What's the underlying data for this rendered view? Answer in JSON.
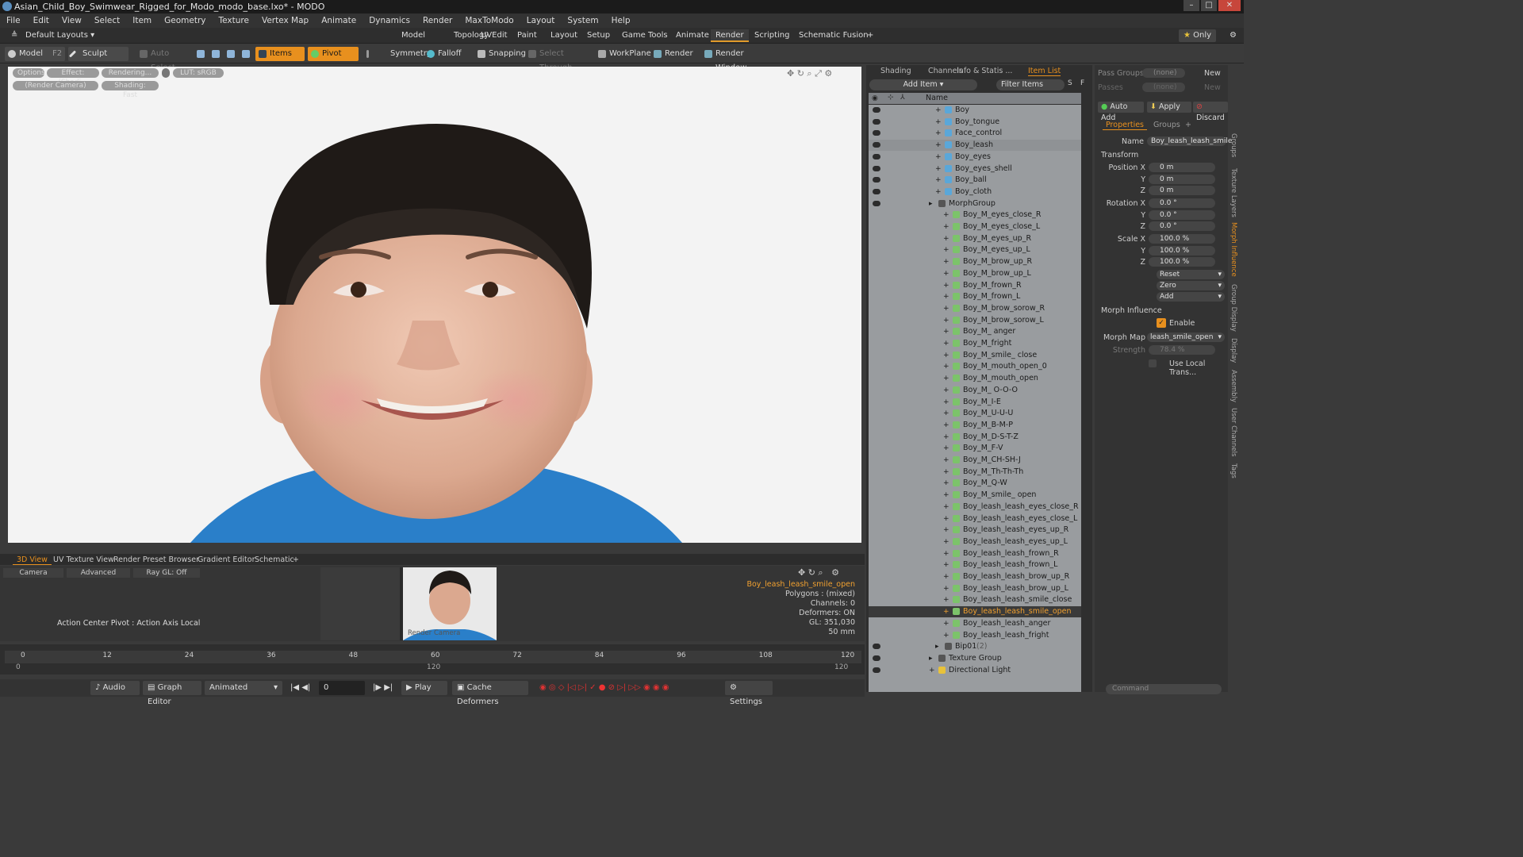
{
  "window": {
    "title": "Asian_Child_Boy_Swimwear_Rigged_for_Modo_modo_base.lxo* - MODO"
  },
  "menu": [
    "File",
    "Edit",
    "View",
    "Select",
    "Item",
    "Geometry",
    "Texture",
    "Vertex Map",
    "Animate",
    "Dynamics",
    "Render",
    "MaxToModo",
    "Layout",
    "System",
    "Help"
  ],
  "layout_label": "Default Layouts",
  "top_tabs": [
    "Model",
    "Topology",
    "UVEdit",
    "Paint",
    "Layout",
    "Setup",
    "Game Tools",
    "Animate",
    "Render",
    "Scripting",
    "Schematic Fusion"
  ],
  "active_top_tab": "Render",
  "only_label": "Only",
  "toolbar": {
    "model": "Model",
    "f2": "F2",
    "sculpt": "Sculpt",
    "auto_select": "Auto Select",
    "items": "Items",
    "pivot": "Pivot",
    "symmetry": "Symmetry",
    "falloff": "Falloff",
    "snapping": "Snapping",
    "select_through": "Select Through",
    "workplane": "WorkPlane",
    "render": "Render",
    "render_window": "Render Window"
  },
  "viewport": {
    "options": "Options",
    "effect": "Effect: (Shadi...",
    "rendering": "Rendering...",
    "lut": "LUT: sRGB",
    "render_camera": "(Render Camera)",
    "shading": "Shading: Fast"
  },
  "bottom_tabs": [
    "3D View",
    "UV Texture View",
    "Render Preset Browser",
    "Gradient Editor",
    "Schematic"
  ],
  "lower": {
    "camera": "Camera",
    "advanced": "Advanced",
    "raygl": "Ray GL: Off",
    "action_center": "Action Center Pivot : Action Axis Local",
    "render_camera": "Render Camera",
    "info_name": "Boy_leash_leash_smile_open",
    "info_lines": [
      "Polygons : (mixed)",
      "Channels: 0",
      "Deformers: ON",
      "GL: 351,030",
      "50 mm"
    ]
  },
  "timeline_ticks": [
    "0",
    "12",
    "24",
    "36",
    "48",
    "60",
    "72",
    "84",
    "96",
    "108",
    "120"
  ],
  "timeline_bottom": {
    "start": "0",
    "mid": "120",
    "end": "120"
  },
  "playbar": {
    "audio": "Audio",
    "graph_editor": "Graph Editor",
    "animated": "Animated",
    "frame": "0",
    "play": "Play",
    "cache": "Cache Deformers",
    "settings": "Settings"
  },
  "right_tabs": [
    "Shading",
    "Channels",
    "Info & Statis ...",
    "Item List"
  ],
  "add_item": "Add Item",
  "filter_items": "Filter Items",
  "tree_header": "Name",
  "tree": [
    {
      "label": "Boy",
      "indent": 1,
      "icon": "mesh"
    },
    {
      "label": "Boy_tongue",
      "indent": 1,
      "icon": "mesh"
    },
    {
      "label": "Face_control",
      "indent": 1,
      "icon": "mesh"
    },
    {
      "label": "Boy_leash",
      "indent": 1,
      "icon": "mesh",
      "hl": true
    },
    {
      "label": "Boy_eyes",
      "indent": 1,
      "icon": "mesh"
    },
    {
      "label": "Boy_eyes_shell",
      "indent": 1,
      "icon": "mesh"
    },
    {
      "label": "Boy_ball",
      "indent": 1,
      "icon": "mesh"
    },
    {
      "label": "Boy_cloth",
      "indent": 1,
      "icon": "mesh"
    },
    {
      "label": "MorphGroup",
      "indent": 0,
      "icon": "group"
    },
    {
      "label": "Boy_M_eyes_close_R",
      "indent": 2,
      "icon": "morph"
    },
    {
      "label": "Boy_M_eyes_close_L",
      "indent": 2,
      "icon": "morph"
    },
    {
      "label": "Boy_M_eyes_up_R",
      "indent": 2,
      "icon": "morph"
    },
    {
      "label": "Boy_M_eyes_up_L",
      "indent": 2,
      "icon": "morph"
    },
    {
      "label": "Boy_M_brow_up_R",
      "indent": 2,
      "icon": "morph"
    },
    {
      "label": "Boy_M_brow_up_L",
      "indent": 2,
      "icon": "morph"
    },
    {
      "label": "Boy_M_frown_R",
      "indent": 2,
      "icon": "morph"
    },
    {
      "label": "Boy_M_frown_L",
      "indent": 2,
      "icon": "morph"
    },
    {
      "label": "Boy_M_brow_sorow_R",
      "indent": 2,
      "icon": "morph"
    },
    {
      "label": "Boy_M_brow_sorow_L",
      "indent": 2,
      "icon": "morph"
    },
    {
      "label": "Boy_M_ anger",
      "indent": 2,
      "icon": "morph"
    },
    {
      "label": "Boy_M_fright",
      "indent": 2,
      "icon": "morph"
    },
    {
      "label": "Boy_M_smile_ close",
      "indent": 2,
      "icon": "morph"
    },
    {
      "label": "Boy_M_mouth_open_0",
      "indent": 2,
      "icon": "morph"
    },
    {
      "label": "Boy_M_mouth_open",
      "indent": 2,
      "icon": "morph"
    },
    {
      "label": "Boy_M_ O-O-O",
      "indent": 2,
      "icon": "morph"
    },
    {
      "label": "Boy_M_I-E",
      "indent": 2,
      "icon": "morph"
    },
    {
      "label": "Boy_M_U-U-U",
      "indent": 2,
      "icon": "morph"
    },
    {
      "label": "Boy_M_B-M-P",
      "indent": 2,
      "icon": "morph"
    },
    {
      "label": "Boy_M_D-S-T-Z",
      "indent": 2,
      "icon": "morph"
    },
    {
      "label": "Boy_M_F-V",
      "indent": 2,
      "icon": "morph"
    },
    {
      "label": "Boy_M_CH-SH-J",
      "indent": 2,
      "icon": "morph"
    },
    {
      "label": "Boy_M_Th-Th-Th",
      "indent": 2,
      "icon": "morph"
    },
    {
      "label": "Boy_M_Q-W",
      "indent": 2,
      "icon": "morph"
    },
    {
      "label": "Boy_M_smile_ open",
      "indent": 2,
      "icon": "morph"
    },
    {
      "label": "Boy_leash_leash_eyes_close_R",
      "indent": 2,
      "icon": "morph"
    },
    {
      "label": "Boy_leash_leash_eyes_close_L",
      "indent": 2,
      "icon": "morph"
    },
    {
      "label": "Boy_leash_leash_eyes_up_R",
      "indent": 2,
      "icon": "morph"
    },
    {
      "label": "Boy_leash_leash_eyes_up_L",
      "indent": 2,
      "icon": "morph"
    },
    {
      "label": "Boy_leash_leash_frown_R",
      "indent": 2,
      "icon": "morph"
    },
    {
      "label": "Boy_leash_leash_frown_L",
      "indent": 2,
      "icon": "morph"
    },
    {
      "label": "Boy_leash_leash_brow_up_R",
      "indent": 2,
      "icon": "morph"
    },
    {
      "label": "Boy_leash_leash_brow_up_L",
      "indent": 2,
      "icon": "morph"
    },
    {
      "label": "Boy_leash_leash_smile_close",
      "indent": 2,
      "icon": "morph"
    },
    {
      "label": "Boy_leash_leash_smile_open",
      "indent": 2,
      "icon": "morph",
      "sel": true
    },
    {
      "label": "Boy_leash_leash_anger",
      "indent": 2,
      "icon": "morph"
    },
    {
      "label": "Boy_leash_leash_fright",
      "indent": 2,
      "icon": "morph"
    },
    {
      "label": "Bip01",
      "indent": 1,
      "icon": "group",
      "suffix": "(2)"
    },
    {
      "label": "Texture Group",
      "indent": 0,
      "icon": "group"
    },
    {
      "label": "Directional Light",
      "indent": 0,
      "icon": "light"
    }
  ],
  "props": {
    "pass_groups": "Pass Groups",
    "none1": "(none)",
    "new1": "New",
    "passes": "Passes",
    "none2": "(none)",
    "new2": "New",
    "auto_add": "Auto Add",
    "apply": "Apply",
    "discard": "Discard",
    "tab_properties": "Properties",
    "tab_groups": "Groups",
    "name_label": "Name",
    "name_value": "Boy_leash_leash_smile",
    "transform": "Transform",
    "pos_label": "Position X",
    "rot_label": "Rotation X",
    "scale_label": "Scale X",
    "y": "Y",
    "z": "Z",
    "pos": [
      "0 m",
      "0 m",
      "0 m"
    ],
    "rot": [
      "0.0 °",
      "0.0 °",
      "0.0 °"
    ],
    "scale": [
      "100.0 %",
      "100.0 %",
      "100.0 %"
    ],
    "reset": "Reset",
    "zero": "Zero",
    "add": "Add",
    "morph_influence": "Morph Influence",
    "enable": "Enable",
    "morph_map_label": "Morph Map",
    "morph_map": "leash_smile_open",
    "strength_label": "Strength",
    "strength": "78.4 %",
    "use_local": "Use Local Trans..."
  },
  "side_tabs": [
    "Groups",
    "Texture Layers",
    "Morph Influence",
    "Group Display",
    "Display",
    "Assembly",
    "User Channels",
    "Tags"
  ],
  "command": "Command"
}
